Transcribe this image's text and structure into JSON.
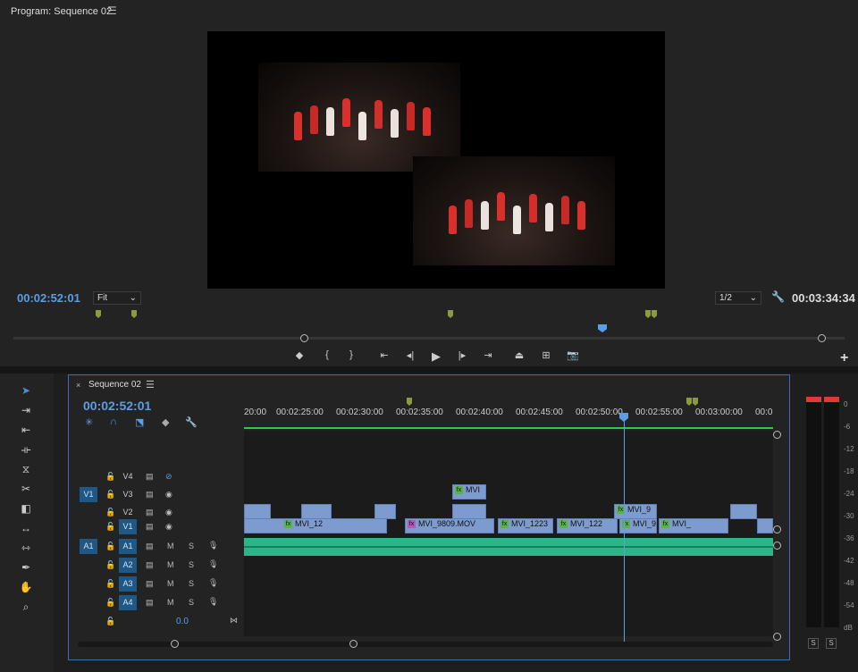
{
  "program": {
    "title": "Program: Sequence 02",
    "menu_icon": "hamburger-menu-icon",
    "timecode": "00:02:52:01",
    "zoom": "Fit",
    "resolution": "1/2",
    "duration": "00:03:34:34"
  },
  "controls": {
    "icons": [
      "add-marker-icon",
      "mark-in-icon",
      "mark-out-icon",
      "go-to-in-icon",
      "step-back-icon",
      "play-icon",
      "step-forward-icon",
      "go-to-out-icon",
      "lift-icon",
      "extract-icon",
      "export-frame-icon",
      "add-button-icon"
    ]
  },
  "tools": [
    "selection-tool-icon",
    "track-select-tool-icon",
    "ripple-edit-tool-icon",
    "rolling-edit-tool-icon",
    "rate-stretch-tool-icon",
    "razor-tool-icon",
    "slip-tool-icon",
    "slide-tool-icon",
    "pen-tool-icon",
    "hand-tool-icon",
    "zoom-tool-icon"
  ],
  "timeline": {
    "close": "×",
    "title": "Sequence 02",
    "timecode": "00:02:52:01",
    "ruler": [
      "20:00",
      "00:02:25:00",
      "00:02:30:00",
      "00:02:35:00",
      "00:02:40:00",
      "00:02:45:00",
      "00:02:50:00",
      "00:02:55:00",
      "00:03:00:00",
      "00:0"
    ],
    "video_tracks": [
      {
        "name": "V4",
        "source": ""
      },
      {
        "name": "V3",
        "source": "V1"
      },
      {
        "name": "V2",
        "source": ""
      },
      {
        "name": "V1",
        "source": ""
      }
    ],
    "audio_tracks": [
      {
        "name": "A1",
        "source": "A1",
        "m": "M",
        "s": "S"
      },
      {
        "name": "A2",
        "source": "",
        "m": "M",
        "s": "S"
      },
      {
        "name": "A3",
        "source": "",
        "m": "M",
        "s": "S"
      },
      {
        "name": "A4",
        "source": "",
        "m": "M",
        "s": "S"
      }
    ],
    "volume": "0.0",
    "clips_v3": [
      "MVI"
    ],
    "clips_v2": [
      "MVI_9"
    ],
    "clips_v1": [
      "MVI_12",
      "MVI_9809.MOV",
      "MVI_1223",
      "MVI_122",
      "MVI_9",
      "MVI_"
    ]
  },
  "meters": {
    "scale": [
      "0",
      "-6",
      "-12",
      "-18",
      "-24",
      "-30",
      "-36",
      "-42",
      "-48",
      "-54",
      "dB"
    ],
    "solo": [
      "S",
      "S"
    ]
  }
}
